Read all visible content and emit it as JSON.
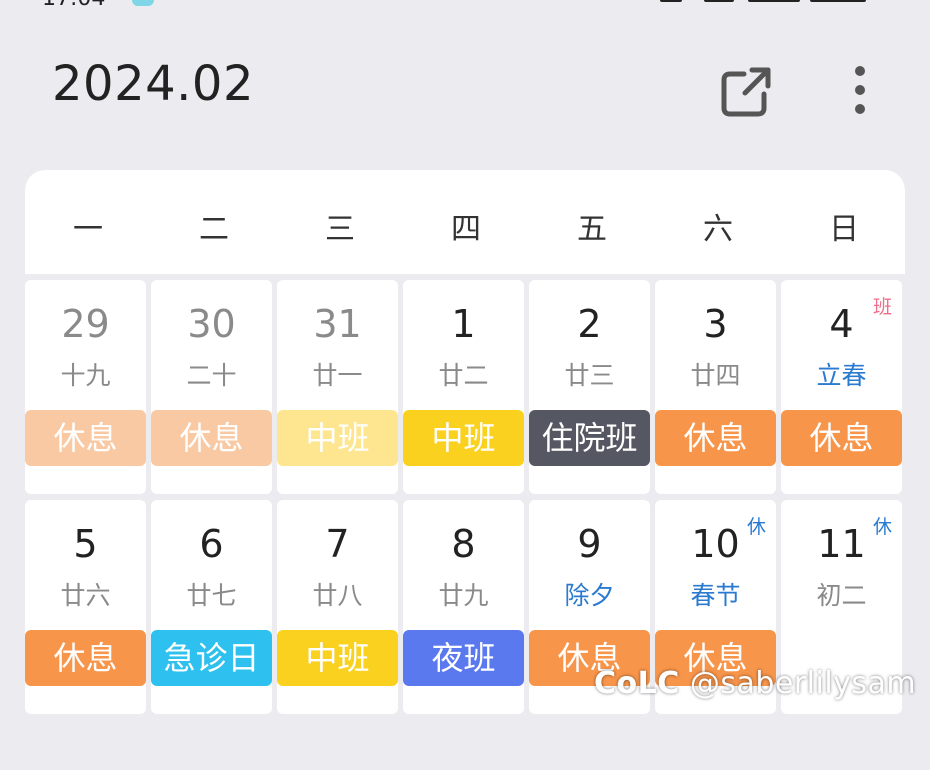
{
  "header": {
    "title": "2024.02"
  },
  "weekdays": [
    "一",
    "二",
    "三",
    "四",
    "五",
    "六",
    "日"
  ],
  "rows": [
    [
      {
        "day": "29",
        "lunar": "十九",
        "shift": "休息",
        "dim": true,
        "lunar_type": "normal",
        "badge": "",
        "shift_color": "#f9c9a3"
      },
      {
        "day": "30",
        "lunar": "二十",
        "shift": "休息",
        "dim": true,
        "lunar_type": "normal",
        "badge": "",
        "shift_color": "#f9c9a3"
      },
      {
        "day": "31",
        "lunar": "廿一",
        "shift": "中班",
        "dim": true,
        "lunar_type": "normal",
        "badge": "",
        "shift_color": "#fde68f"
      },
      {
        "day": "1",
        "lunar": "廿二",
        "shift": "中班",
        "dim": false,
        "lunar_type": "normal",
        "badge": "",
        "shift_color": "#f9d11e"
      },
      {
        "day": "2",
        "lunar": "廿三",
        "shift": "住院班",
        "dim": false,
        "lunar_type": "normal",
        "badge": "",
        "shift_color": "#555862"
      },
      {
        "day": "3",
        "lunar": "廿四",
        "shift": "休息",
        "dim": false,
        "lunar_type": "normal",
        "badge": "",
        "shift_color": "#f7954b"
      },
      {
        "day": "4",
        "lunar": "立春",
        "shift": "休息",
        "dim": false,
        "lunar_type": "festival",
        "badge": "班",
        "badge_type": "work",
        "shift_color": "#f7954b"
      }
    ],
    [
      {
        "day": "5",
        "lunar": "廿六",
        "shift": "休息",
        "dim": false,
        "lunar_type": "normal",
        "badge": "",
        "shift_color": "#f7954b"
      },
      {
        "day": "6",
        "lunar": "廿七",
        "shift": "急诊日",
        "dim": false,
        "lunar_type": "normal",
        "badge": "",
        "shift_color": "#2ec0ee"
      },
      {
        "day": "7",
        "lunar": "廿八",
        "shift": "中班",
        "dim": false,
        "lunar_type": "normal",
        "badge": "",
        "shift_color": "#f9d11e"
      },
      {
        "day": "8",
        "lunar": "廿九",
        "shift": "夜班",
        "dim": false,
        "lunar_type": "normal",
        "badge": "",
        "shift_color": "#5b79ee"
      },
      {
        "day": "9",
        "lunar": "除夕",
        "shift": "休息",
        "dim": false,
        "lunar_type": "festival",
        "badge": "",
        "shift_color": "#f7954b"
      },
      {
        "day": "10",
        "lunar": "春节",
        "shift": "休息",
        "dim": false,
        "lunar_type": "festival",
        "badge": "休",
        "badge_type": "rest",
        "shift_color": "#f7954b"
      },
      {
        "day": "11",
        "lunar": "初二",
        "shift": "",
        "dim": false,
        "lunar_type": "normal",
        "badge": "休",
        "badge_type": "rest",
        "shift_color": ""
      }
    ]
  ],
  "watermark": "@saberlilysam"
}
